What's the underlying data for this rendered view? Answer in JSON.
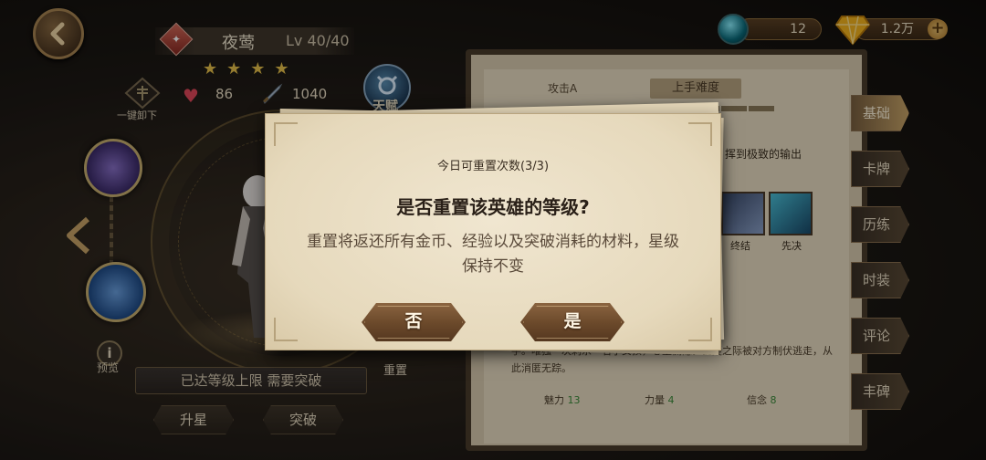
{
  "hero": {
    "name": "夜莺",
    "level": "Lv 40/40",
    "stars": "★★★★",
    "hp": "86",
    "attack": "1040"
  },
  "left_panel": {
    "unequip_label": "一键卸下",
    "talent_label": "天赋",
    "preview_label": "预览",
    "level_cap_notice": "已达等级上限 需要突破",
    "level_up_button": "升星",
    "breakthrough_button": "突破",
    "reset_label": "重置"
  },
  "currency": {
    "gems": "12",
    "gold": "1.2万"
  },
  "info_panel": {
    "attack_label": "攻击A",
    "difficulty_label": "上手难度",
    "output_text": "挥到极致的输出",
    "skill_names": [
      "终结",
      "先决"
    ],
    "description": "手。唯独一次刺杀一名小女孩，心生侧隐。犹疑之际被对方制伏逃走，从此消匿无踪。",
    "stats": [
      {
        "label": "魅力",
        "value": "13"
      },
      {
        "label": "力量",
        "value": "4"
      },
      {
        "label": "信念",
        "value": "8"
      }
    ]
  },
  "side_tabs": [
    "基础",
    "卡牌",
    "历练",
    "时装",
    "评论",
    "丰碑"
  ],
  "dialog": {
    "reset_count": "今日可重置次数(3/3)",
    "title": "是否重置该英雄的等级?",
    "body": "重置将返还所有金币、经验以及突破消耗的材料，星级保持不变",
    "no_button": "否",
    "yes_button": "是"
  },
  "colors": {
    "accent_gold": "#c8a468",
    "button_brown": "#6a482a",
    "paper": "#e6d9bc"
  }
}
